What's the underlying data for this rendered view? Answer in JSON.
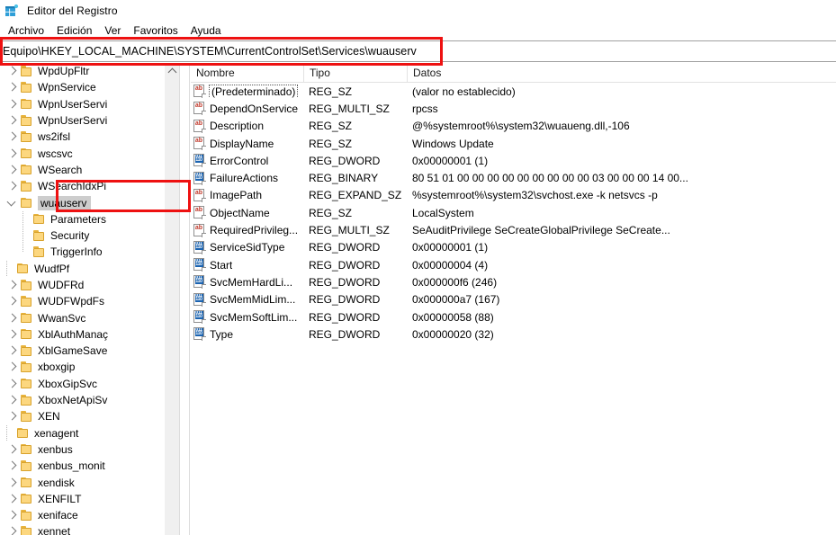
{
  "window": {
    "title": "Editor del Registro",
    "icon": "registry-editor-icon"
  },
  "menubar": {
    "items": [
      {
        "label": "Archivo"
      },
      {
        "label": "Edición"
      },
      {
        "label": "Ver"
      },
      {
        "label": "Favoritos"
      },
      {
        "label": "Ayuda"
      }
    ]
  },
  "address": {
    "value": "Equipo\\HKEY_LOCAL_MACHINE\\SYSTEM\\CurrentControlSet\\Services\\wuauserv"
  },
  "annotations": {
    "accent_color": "#ee1111",
    "boxes": [
      {
        "name": "address-bar-highlight"
      },
      {
        "name": "wuauserv-key-highlight"
      }
    ]
  },
  "tree": {
    "scrollbar": {
      "up_arrow": "chevron-up-icon"
    },
    "items": [
      {
        "label": "WpdUpFltr",
        "indent": 1,
        "expander": "right",
        "selected": false
      },
      {
        "label": "WpnService",
        "indent": 1,
        "expander": "right",
        "selected": false
      },
      {
        "label": "WpnUserServi",
        "indent": 1,
        "expander": "right",
        "selected": false
      },
      {
        "label": "WpnUserServi",
        "indent": 1,
        "expander": "right",
        "selected": false
      },
      {
        "label": "ws2ifsl",
        "indent": 1,
        "expander": "right",
        "selected": false
      },
      {
        "label": "wscsvc",
        "indent": 1,
        "expander": "right",
        "selected": false
      },
      {
        "label": "WSearch",
        "indent": 1,
        "expander": "right",
        "selected": false
      },
      {
        "label": "WSearchIdxPi",
        "indent": 1,
        "expander": "right",
        "selected": false
      },
      {
        "label": "wuauserv",
        "indent": 1,
        "expander": "down",
        "selected": true
      },
      {
        "label": "Parameters",
        "indent": 2,
        "expander": "leaf",
        "selected": false
      },
      {
        "label": "Security",
        "indent": 2,
        "expander": "leaf",
        "selected": false
      },
      {
        "label": "TriggerInfo",
        "indent": 2,
        "expander": "leafend",
        "selected": false
      },
      {
        "label": "WudfPf",
        "indent": 1,
        "expander": "leaf",
        "selected": false
      },
      {
        "label": "WUDFRd",
        "indent": 1,
        "expander": "right",
        "selected": false
      },
      {
        "label": "WUDFWpdFs",
        "indent": 1,
        "expander": "right",
        "selected": false
      },
      {
        "label": "WwanSvc",
        "indent": 1,
        "expander": "right",
        "selected": false
      },
      {
        "label": "XblAuthManaç",
        "indent": 1,
        "expander": "right",
        "selected": false
      },
      {
        "label": "XblGameSave",
        "indent": 1,
        "expander": "right",
        "selected": false
      },
      {
        "label": "xboxgip",
        "indent": 1,
        "expander": "right",
        "selected": false
      },
      {
        "label": "XboxGipSvc",
        "indent": 1,
        "expander": "right",
        "selected": false
      },
      {
        "label": "XboxNetApiSv",
        "indent": 1,
        "expander": "right",
        "selected": false
      },
      {
        "label": "XEN",
        "indent": 1,
        "expander": "right",
        "selected": false
      },
      {
        "label": "xenagent",
        "indent": 1,
        "expander": "leaf",
        "selected": false
      },
      {
        "label": "xenbus",
        "indent": 1,
        "expander": "right",
        "selected": false
      },
      {
        "label": "xenbus_monit",
        "indent": 1,
        "expander": "right",
        "selected": false
      },
      {
        "label": "xendisk",
        "indent": 1,
        "expander": "right",
        "selected": false
      },
      {
        "label": "XENFILT",
        "indent": 1,
        "expander": "right",
        "selected": false
      },
      {
        "label": "xeniface",
        "indent": 1,
        "expander": "right",
        "selected": false
      },
      {
        "label": "xennet",
        "indent": 1,
        "expander": "right",
        "selected": false
      }
    ]
  },
  "list": {
    "columns": [
      {
        "label": "Nombre"
      },
      {
        "label": "Tipo"
      },
      {
        "label": "Datos"
      }
    ],
    "rows": [
      {
        "name": "(Predeterminado)",
        "type": "REG_SZ",
        "data": "(valor no establecido)",
        "icon": "string-value-icon",
        "focused": true
      },
      {
        "name": "DependOnService",
        "type": "REG_MULTI_SZ",
        "data": "rpcss",
        "icon": "string-value-icon",
        "focused": false
      },
      {
        "name": "Description",
        "type": "REG_SZ",
        "data": "@%systemroot%\\system32\\wuaueng.dll,-106",
        "icon": "string-value-icon",
        "focused": false
      },
      {
        "name": "DisplayName",
        "type": "REG_SZ",
        "data": "Windows Update",
        "icon": "string-value-icon",
        "focused": false
      },
      {
        "name": "ErrorControl",
        "type": "REG_DWORD",
        "data": "0x00000001 (1)",
        "icon": "dword-value-icon",
        "focused": false
      },
      {
        "name": "FailureActions",
        "type": "REG_BINARY",
        "data": "80 51 01 00 00 00 00 00 00 00 00 00 03 00 00 00 14 00...",
        "icon": "dword-value-icon",
        "focused": false
      },
      {
        "name": "ImagePath",
        "type": "REG_EXPAND_SZ",
        "data": "%systemroot%\\system32\\svchost.exe -k netsvcs -p",
        "icon": "string-value-icon",
        "focused": false
      },
      {
        "name": "ObjectName",
        "type": "REG_SZ",
        "data": "LocalSystem",
        "icon": "string-value-icon",
        "focused": false
      },
      {
        "name": "RequiredPrivileg...",
        "type": "REG_MULTI_SZ",
        "data": "SeAuditPrivilege SeCreateGlobalPrivilege SeCreate...",
        "icon": "string-value-icon",
        "focused": false
      },
      {
        "name": "ServiceSidType",
        "type": "REG_DWORD",
        "data": "0x00000001 (1)",
        "icon": "dword-value-icon",
        "focused": false
      },
      {
        "name": "Start",
        "type": "REG_DWORD",
        "data": "0x00000004 (4)",
        "icon": "dword-value-icon",
        "focused": false
      },
      {
        "name": "SvcMemHardLi...",
        "type": "REG_DWORD",
        "data": "0x000000f6 (246)",
        "icon": "dword-value-icon",
        "focused": false
      },
      {
        "name": "SvcMemMidLim...",
        "type": "REG_DWORD",
        "data": "0x000000a7 (167)",
        "icon": "dword-value-icon",
        "focused": false
      },
      {
        "name": "SvcMemSoftLim...",
        "type": "REG_DWORD",
        "data": "0x00000058 (88)",
        "icon": "dword-value-icon",
        "focused": false
      },
      {
        "name": "Type",
        "type": "REG_DWORD",
        "data": "0x00000020 (32)",
        "icon": "dword-value-icon",
        "focused": false
      }
    ]
  }
}
